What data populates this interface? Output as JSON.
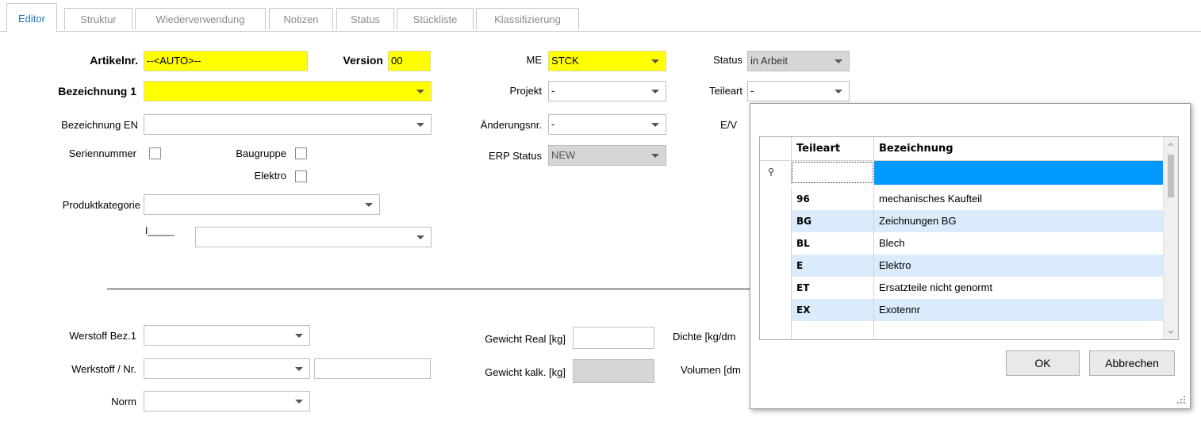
{
  "tabs": [
    "Editor",
    "Struktur",
    "Wiederverwendung",
    "Notizen",
    "Status",
    "Stückliste",
    "Klassifizierung"
  ],
  "form": {
    "artikelnr_label": "Artikelnr.",
    "artikelnr_value": "--<AUTO>--",
    "version_label": "Version",
    "version_value": "00",
    "bez1_label": "Bezeichnung 1",
    "bez1_value": "",
    "bezen_label": "Bezeichnung EN",
    "bezen_value": "",
    "seriennummer_label": "Seriennummer",
    "baugruppe_label": "Baugruppe",
    "elektro_label": "Elektro",
    "produktkategorie_label": "Produktkategorie",
    "produktkategorie_value": "",
    "sub_marker": "I_____",
    "sub_value": "",
    "me_label": "ME",
    "me_value": "STCK",
    "projekt_label": "Projekt",
    "projekt_value": "-",
    "aenderungsnr_label": "Änderungsnr.",
    "aenderungsnr_value": "-",
    "erp_label": "ERP Status",
    "erp_value": "NEW",
    "status_label": "Status",
    "status_value": "in Arbeit",
    "teileart_label": "Teileart",
    "teileart_value": "-",
    "ev_label": "E/V",
    "werkstoff_bez_label": "Werstoff Bez.1",
    "werkstoff_bez_value": "",
    "werkstoff_nr_label": "Werkstoff / Nr.",
    "werkstoff_nr_value": "",
    "werkstoff_nr_text": "",
    "norm_label": "Norm",
    "norm_value": "",
    "gewicht_real_label": "Gewicht Real [kg]",
    "gewicht_real_value": "",
    "gewicht_kalk_label": "Gewicht kalk. [kg]",
    "gewicht_kalk_value": "",
    "dichte_label": "Dichte [kg/dm",
    "volumen_label": "Volumen [dm"
  },
  "popup": {
    "headers": [
      "Teileart",
      "Bezeichnung"
    ],
    "filter_icon": "key-filter-icon",
    "rows": [
      {
        "code": "96",
        "name": "mechanisches Kaufteil"
      },
      {
        "code": "BG",
        "name": "Zeichnungen BG"
      },
      {
        "code": "BL",
        "name": "Blech"
      },
      {
        "code": "E",
        "name": "Elektro"
      },
      {
        "code": "ET",
        "name": "Ersatzteile nicht genormt"
      },
      {
        "code": "EX",
        "name": "Exotennr"
      }
    ],
    "ok_label": "OK",
    "cancel_label": "Abbrechen"
  },
  "colors": {
    "required_field": "#ffff00",
    "active_tab_text": "#1e73be",
    "row_highlight": "#daecfb",
    "filter_selected": "#0099ff"
  }
}
